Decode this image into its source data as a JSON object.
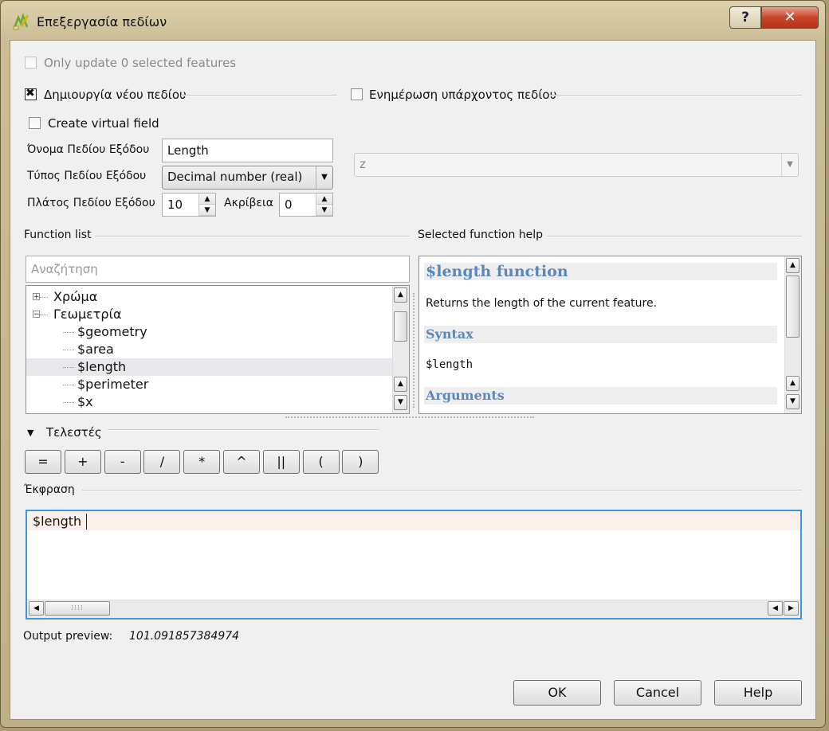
{
  "window": {
    "title": "Επεξεργασία πεδίων",
    "help_label": "?",
    "close_label": "✕"
  },
  "only_update": {
    "label": "Only update 0 selected features",
    "checked": false
  },
  "create_new": {
    "label": "Δημιουργία νέου πεδίου",
    "checked": true
  },
  "update_existing": {
    "label": "Ενημέρωση υπάρχοντος πεδίου",
    "checked": false
  },
  "virtual_field": {
    "label": "Create virtual field",
    "checked": false
  },
  "output_name": {
    "label": "Όνομα Πεδίου Εξόδου",
    "value": "Length"
  },
  "output_type": {
    "label": "Τύπος Πεδίου Εξόδου",
    "value": "Decimal number (real)"
  },
  "output_width": {
    "label": "Πλάτος Πεδίου Εξόδου",
    "value": "10"
  },
  "precision": {
    "label": "Ακρίβεια",
    "value": "0"
  },
  "existing_field": {
    "value": "z"
  },
  "function_list": {
    "title": "Function list",
    "search_placeholder": "Αναζήτηση",
    "groups": [
      {
        "label": "Χρώμα",
        "expanded": false
      },
      {
        "label": "Γεωμετρία",
        "expanded": true
      }
    ],
    "items": [
      "$geometry",
      "$area",
      "$length",
      "$perimeter",
      "$x"
    ],
    "selected": "$length"
  },
  "function_help": {
    "title": "Selected function help",
    "heading": "$length function",
    "description": "Returns the length of the current feature.",
    "syntax_heading": "Syntax",
    "syntax": "$length",
    "arguments_heading": "Arguments"
  },
  "operators": {
    "title": "Τελεστές",
    "buttons": [
      "=",
      "+",
      "-",
      "/",
      "*",
      "^",
      "||",
      "(",
      ")"
    ]
  },
  "expression": {
    "title": "Έκφραση",
    "value": "$length"
  },
  "preview": {
    "label": "Output preview:",
    "value": "101.091857384974"
  },
  "buttons": {
    "ok": "OK",
    "cancel": "Cancel",
    "help": "Help"
  }
}
